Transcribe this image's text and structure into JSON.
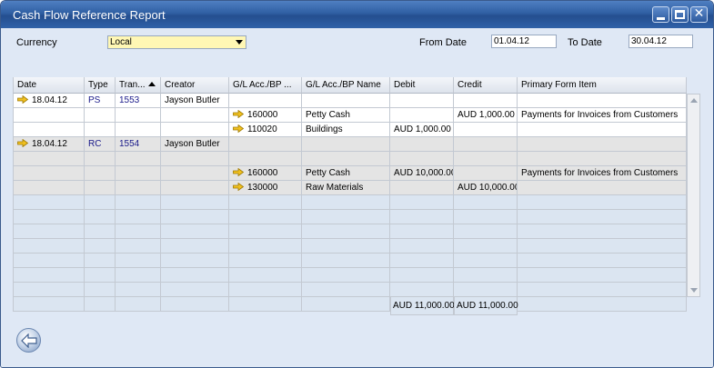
{
  "window": {
    "title": "Cash Flow Reference Report"
  },
  "filters": {
    "currency_label": "Currency",
    "currency_value": "Local",
    "from_date_label": "From Date",
    "from_date_value": "01.04.12",
    "to_date_label": "To Date",
    "to_date_value": "30.04.12"
  },
  "table": {
    "columns": [
      "Date",
      "Type",
      "Tran...",
      "Creator",
      "G/L Acc./BP ...",
      "G/L Acc./BP Name",
      "Debit",
      "Credit",
      "Primary Form Item"
    ],
    "sorted_column": "Tran...",
    "rows": [
      {
        "style": "white",
        "arrow_col": 0,
        "cells": [
          "18.04.12",
          "PS",
          "1553",
          "Jayson Butler",
          "",
          "",
          "",
          "",
          ""
        ]
      },
      {
        "style": "white",
        "arrow_col": 4,
        "cells": [
          "",
          "",
          "",
          "",
          "160000",
          "Petty Cash",
          "",
          "AUD 1,000.00",
          "Payments for Invoices from Customers"
        ]
      },
      {
        "style": "white",
        "arrow_col": 4,
        "cells": [
          "",
          "",
          "",
          "",
          "110020",
          "Buildings",
          "AUD 1,000.00",
          "",
          ""
        ]
      },
      {
        "style": "gray",
        "arrow_col": 0,
        "cells": [
          "18.04.12",
          "RC",
          "1554",
          "Jayson Butler",
          "",
          "",
          "",
          "",
          ""
        ]
      },
      {
        "style": "gray",
        "arrow_col": -1,
        "cells": [
          "",
          "",
          "",
          "",
          "",
          "",
          "",
          "",
          ""
        ]
      },
      {
        "style": "gray",
        "arrow_col": 4,
        "cells": [
          "",
          "",
          "",
          "",
          "160000",
          "Petty Cash",
          "AUD 10,000.00",
          "",
          "Payments for Invoices from Customers"
        ]
      },
      {
        "style": "gray",
        "arrow_col": 4,
        "cells": [
          "",
          "",
          "",
          "",
          "130000",
          "Raw Materials",
          "",
          "AUD 10,000.00",
          ""
        ]
      },
      {
        "style": "blue",
        "arrow_col": -1,
        "cells": [
          "",
          "",
          "",
          "",
          "",
          "",
          "",
          "",
          ""
        ]
      },
      {
        "style": "blue",
        "arrow_col": -1,
        "cells": [
          "",
          "",
          "",
          "",
          "",
          "",
          "",
          "",
          ""
        ]
      },
      {
        "style": "blue",
        "arrow_col": -1,
        "cells": [
          "",
          "",
          "",
          "",
          "",
          "",
          "",
          "",
          ""
        ]
      },
      {
        "style": "blue",
        "arrow_col": -1,
        "cells": [
          "",
          "",
          "",
          "",
          "",
          "",
          "",
          "",
          ""
        ]
      },
      {
        "style": "blue",
        "arrow_col": -1,
        "cells": [
          "",
          "",
          "",
          "",
          "",
          "",
          "",
          "",
          ""
        ]
      },
      {
        "style": "blue",
        "arrow_col": -1,
        "cells": [
          "",
          "",
          "",
          "",
          "",
          "",
          "",
          "",
          ""
        ]
      },
      {
        "style": "blue",
        "arrow_col": -1,
        "cells": [
          "",
          "",
          "",
          "",
          "",
          "",
          "",
          "",
          ""
        ]
      },
      {
        "style": "blue",
        "arrow_col": -1,
        "cells": [
          "",
          "",
          "",
          "",
          "",
          "",
          "",
          "",
          ""
        ]
      }
    ],
    "totals": {
      "debit": "AUD 11,000.00",
      "credit": "AUD 11,000.00"
    }
  },
  "link_columns": [
    1,
    2
  ],
  "colors": {
    "titlebar": "#2f5fa3",
    "row_link": "#1a1a8a",
    "link_arrow": "#f0c020",
    "highlight_field": "#fff7b4"
  },
  "icons": {
    "row_link": "link-arrow-icon",
    "back": "back-arrow-icon"
  }
}
